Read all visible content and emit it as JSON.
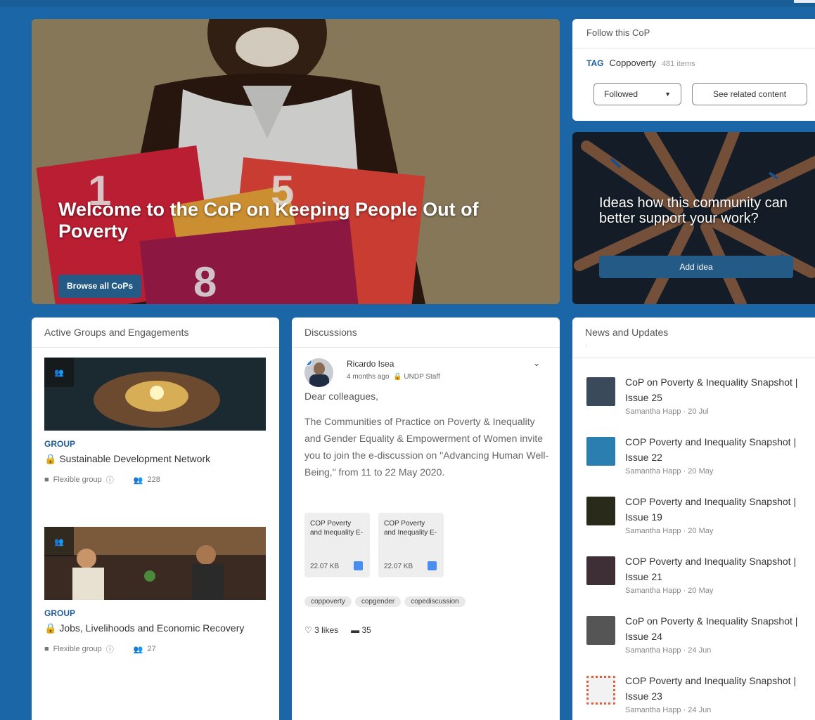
{
  "hero": {
    "title": "Welcome to the CoP on Keeping People Out of Poverty",
    "button_label": "Browse all CoPs"
  },
  "follow": {
    "heading": "Follow this CoP",
    "tag_label": "TAG",
    "tag_name": "Coppoverty",
    "tag_count": "481 items",
    "followed_label": "Followed",
    "related_label": "See related content"
  },
  "ideas": {
    "text": "Ideas how this community can better support your work?",
    "button_label": "Add idea"
  },
  "groups": {
    "heading": "Active Groups and Engagements",
    "items": [
      {
        "type": "GROUP",
        "name": "Sustainable Development Network",
        "meta": "Flexible group",
        "members": "228"
      },
      {
        "type": "GROUP",
        "name": "Jobs, Livelihoods and Economic Recovery",
        "meta": "Flexible group",
        "members": "27"
      }
    ]
  },
  "discussions": {
    "heading": "Discussions",
    "author": "Ricardo Isea",
    "time": "4 months ago",
    "role": "UNDP Staff",
    "greeting": "Dear colleagues,",
    "body": "The Communities of Practice on Poverty & Inequality and Gender Equality & Empowerment of Women invite you to join the e-discussion on \"Advancing Human Well-Being,\" from 11 to 22 May 2020.",
    "attachments": [
      {
        "name": "COP Poverty and Inequality E-",
        "size": "22.07 KB"
      },
      {
        "name": "COP Poverty and Inequality E-",
        "size": "22.07 KB"
      }
    ],
    "tags": [
      "coppoverty",
      "copgender",
      "copediscussion"
    ],
    "likes": "3 likes",
    "comments": "35"
  },
  "news": {
    "heading": "News and Updates",
    "subheading": ".",
    "items": [
      {
        "title": "CoP on Poverty & Inequality Snapshot | Issue 25",
        "byline": "Samantha Happ · 20 Jul"
      },
      {
        "title": "COP Poverty and Inequality Snapshot | Issue 22",
        "byline": "Samantha Happ · 20 May"
      },
      {
        "title": "COP Poverty and Inequality Snapshot | Issue 19",
        "byline": "Samantha Happ · 20 May"
      },
      {
        "title": "COP Poverty and Inequality Snapshot | Issue 21",
        "byline": "Samantha Happ · 20 May"
      },
      {
        "title": "CoP on Poverty & Inequality Snapshot | Issue 24",
        "byline": "Samantha Happ · 24 Jun"
      },
      {
        "title": "COP Poverty and Inequality Snapshot | Issue 23",
        "byline": "Samantha Happ · 24 Jun"
      }
    ]
  },
  "icons": {
    "group": "group-icon",
    "lock": "lock-icon",
    "tag": "tag-icon",
    "info": "info-icon",
    "members": "members-icon",
    "heart": "heart-icon",
    "comment": "comment-icon",
    "chevron": "chevron-down-icon",
    "document": "document-icon"
  },
  "colors": {
    "page_background": "#1a66a6",
    "accent": "#1f5c96",
    "button": "#245a86"
  }
}
